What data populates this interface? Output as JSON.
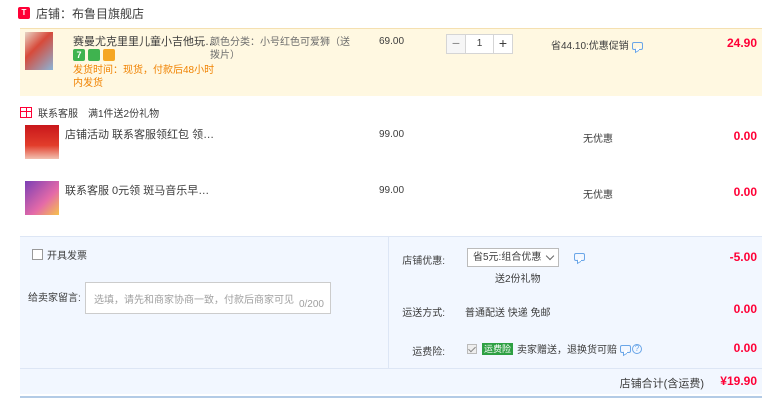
{
  "shop": {
    "badge": "天猫",
    "label": "店铺：",
    "name": "布鲁目旗舰店"
  },
  "items": [
    {
      "title": "赛曼尤克里里儿童小吉他玩具可...",
      "tags": [
        "7",
        "shield-icon",
        "card-icon"
      ],
      "ship_note": "发货时间：现货，付款后48小时内发货",
      "sku": "颜色分类：小号红色可爱狮（送拨片）",
      "price": "69.00",
      "qty": "1",
      "qty_minus": "−",
      "qty_plus": "+",
      "promo": "省44.10:优惠促销",
      "subtotal": "24.90"
    },
    {
      "title": "店铺活动 联系客服领红包 领早...",
      "price": "99.00",
      "promo": "无优惠",
      "subtotal": "0.00"
    },
    {
      "title": "联系客服 0元领 斑马音乐早教课",
      "price": "99.00",
      "promo": "无优惠",
      "subtotal": "0.00"
    }
  ],
  "gift": {
    "title": "联系客服",
    "desc": "满1件送2份礼物"
  },
  "bottom": {
    "invoice_label": "开具发票",
    "message_label": "给卖家留言:",
    "message_placeholder": "选填，请先和商家协商一致，付款后商家可见",
    "message_count": "0/200",
    "coupon_label": "店铺优惠:",
    "coupon_value": "省5元:组合优惠",
    "coupon_gift": "送2份礼物",
    "coupon_amount": "-5.00",
    "shipping_label": "运送方式:",
    "shipping_value": "普通配送 快递 免邮",
    "shipping_amount": "0.00",
    "insurance_label": "运费险:",
    "insurance_badge": "运费险",
    "insurance_desc": "卖家赠送，退换货可赔",
    "insurance_amount": "0.00"
  },
  "total": {
    "label": "店铺合计(含运费)",
    "value": "¥19.90"
  },
  "colors": {
    "accent": "#ff0036",
    "panel_bg": "#f2f7ff",
    "highlight_row": "#fff8e1",
    "ship_note": "#f08200"
  }
}
